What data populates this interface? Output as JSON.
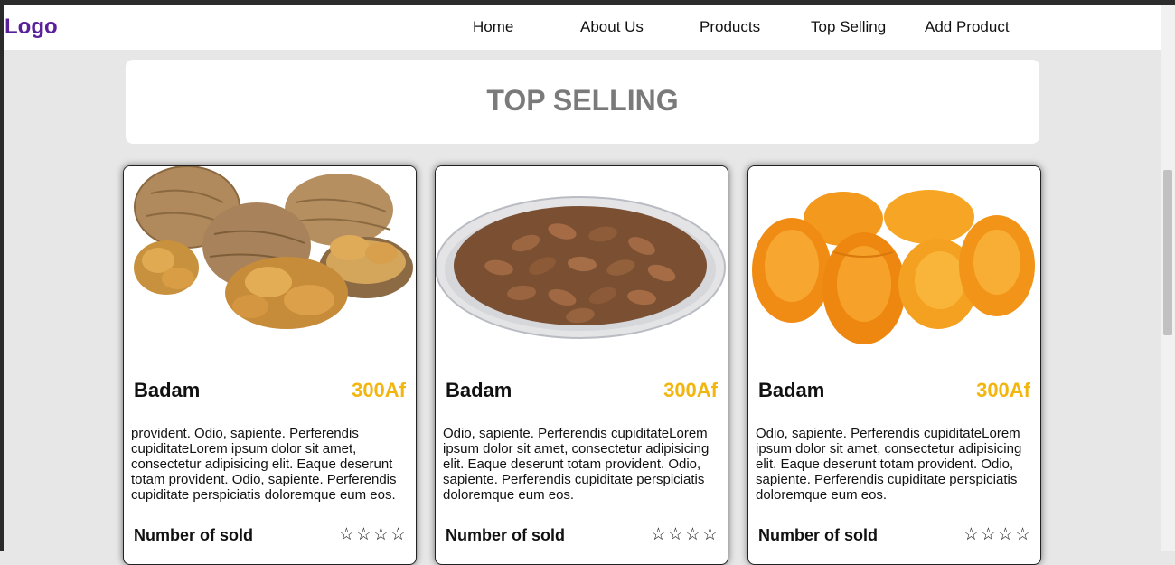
{
  "header": {
    "logo": "Logo",
    "nav": [
      "Home",
      "About Us",
      "Products",
      "Top Selling",
      "Add Product"
    ]
  },
  "page": {
    "title": "TOP SELLING"
  },
  "products": [
    {
      "image": "walnuts",
      "name": "Badam",
      "price": "300Af",
      "description": "provident. Odio, sapiente. Perferendis cupiditateLorem ipsum dolor sit amet, consectetur adipisicing elit. Eaque deserunt totam provident. Odio, sapiente. Perferendis cupiditate perspiciatis doloremque eum eos.",
      "sold_label": "Number of sold",
      "stars": "☆☆☆☆"
    },
    {
      "image": "almonds",
      "name": "Badam",
      "price": "300Af",
      "description": "Odio, sapiente. Perferendis cupiditateLorem ipsum dolor sit amet, consectetur adipisicing elit. Eaque deserunt totam provident. Odio, sapiente. Perferendis cupiditate perspiciatis doloremque eum eos.",
      "sold_label": "Number of sold",
      "stars": "☆☆☆☆"
    },
    {
      "image": "dried-apricots",
      "name": "Badam",
      "price": "300Af",
      "description": "Odio, sapiente. Perferendis cupiditateLorem ipsum dolor sit amet, consectetur adipisicing elit. Eaque deserunt totam provident. Odio, sapiente. Perferendis cupiditate perspiciatis doloremque eum eos.",
      "sold_label": "Number of sold",
      "stars": "☆☆☆☆"
    }
  ],
  "colors": {
    "logo": "#5a1f9a",
    "price": "#f2b60f",
    "title": "#7a7a7a",
    "background": "#e7e7e7"
  }
}
